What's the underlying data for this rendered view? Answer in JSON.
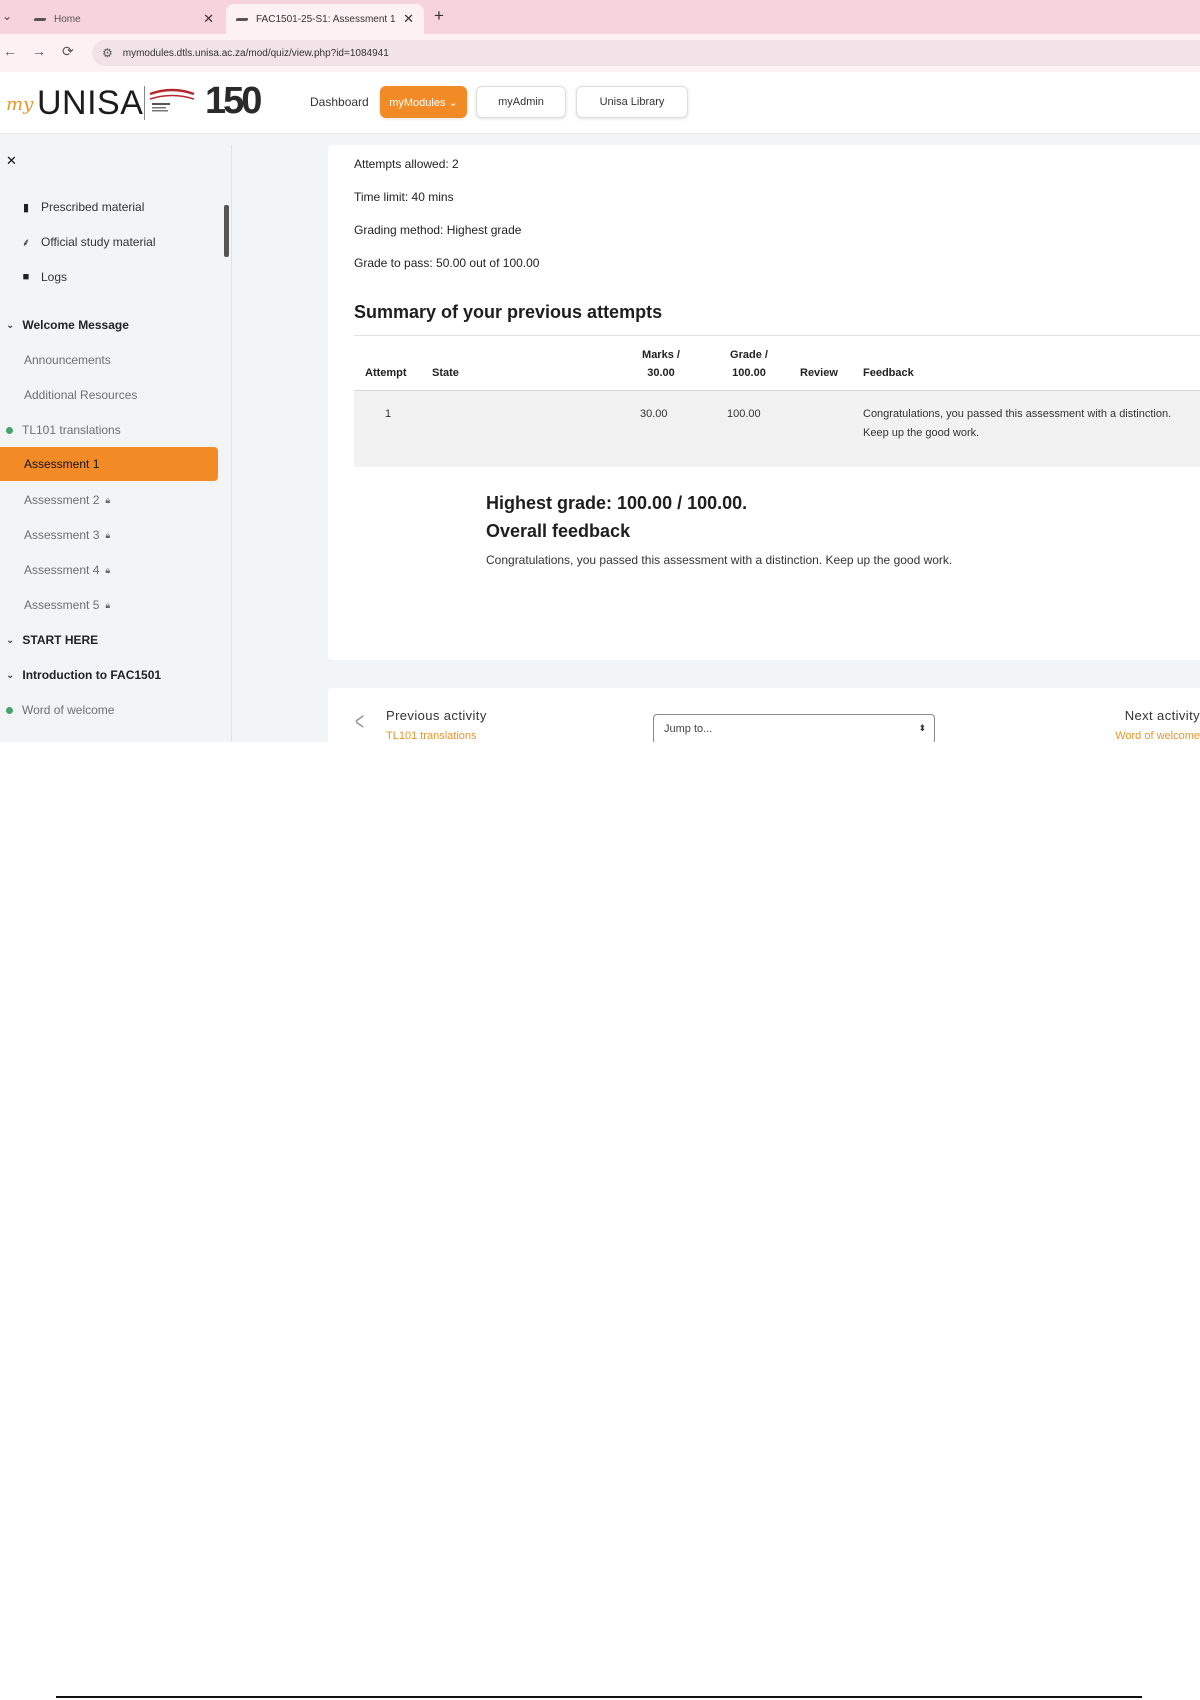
{
  "browser": {
    "tabs": [
      {
        "title": "Home",
        "active": false
      },
      {
        "title": "FAC1501-25-S1: Assessment 1",
        "active": true
      }
    ],
    "tab_close_glyph": "✕",
    "new_tab_glyph": "+",
    "url": "mymodules.dtls.unisa.ac.za/mod/quiz/view.php?id=1084941"
  },
  "header": {
    "logo_my": "my",
    "logo_unisa": "UNISA",
    "logo_150": "150",
    "nav": {
      "dashboard": "Dashboard",
      "mymodules": "myModules ⌄",
      "myadmin": "myAdmin",
      "library": "Unisa Library"
    }
  },
  "sidebar": {
    "items": [
      {
        "label": "Prescribed material",
        "icon": "bookmark-icon"
      },
      {
        "label": "Official study material",
        "icon": "study-material-icon"
      },
      {
        "label": "Logs",
        "icon": "folder-icon"
      },
      {
        "label": "Welcome Message",
        "type": "section"
      },
      {
        "label": "Announcements"
      },
      {
        "label": "Additional Resources"
      },
      {
        "label": "TL101 translations",
        "status": "complete"
      },
      {
        "label": "Assessment 1",
        "active": true
      },
      {
        "label": "Assessment 2",
        "locked": true
      },
      {
        "label": "Assessment 3",
        "locked": true
      },
      {
        "label": "Assessment 4",
        "locked": true
      },
      {
        "label": "Assessment 5",
        "locked": true
      },
      {
        "label": "START HERE",
        "type": "section"
      },
      {
        "label": "Introduction to FAC1501",
        "type": "section"
      },
      {
        "label": "Word of welcome",
        "status": "complete"
      }
    ]
  },
  "quiz_info": {
    "attempts_allowed": "Attempts allowed: 2",
    "time_limit": "Time limit: 40 mins",
    "grading_method": "Grading method: Highest grade",
    "grade_to_pass": "Grade to pass: 50.00 out of 100.00"
  },
  "summary": {
    "heading": "Summary of your previous attempts",
    "columns": {
      "attempt": "Attempt",
      "state": "State",
      "marks_line1": "Marks /",
      "marks_line2": "30.00",
      "grade_line1": "Grade /",
      "grade_line2": "100.00",
      "review": "Review",
      "feedback": "Feedback"
    },
    "rows": [
      {
        "attempt": "1",
        "state": "",
        "marks": "30.00",
        "grade": "100.00",
        "review": "",
        "feedback": "Congratulations, you passed this assessment with a distinction. Keep up the good work."
      }
    ]
  },
  "result": {
    "highest_grade": "Highest grade: 100.00 / 100.00.",
    "overall_feedback_title": "Overall feedback",
    "overall_feedback_text": "Congratulations, you passed this assessment with a distinction. Keep up the good work."
  },
  "activity_nav": {
    "previous_label": "Previous activity",
    "previous_link": "TL101 translations",
    "jump_placeholder": "Jump to...",
    "next_label": "Next activity",
    "next_link": "Word of welcome"
  },
  "colors": {
    "accent": "#f28b25",
    "tab_bar": "#f7d3dd",
    "complete_dot": "#44a36a"
  }
}
